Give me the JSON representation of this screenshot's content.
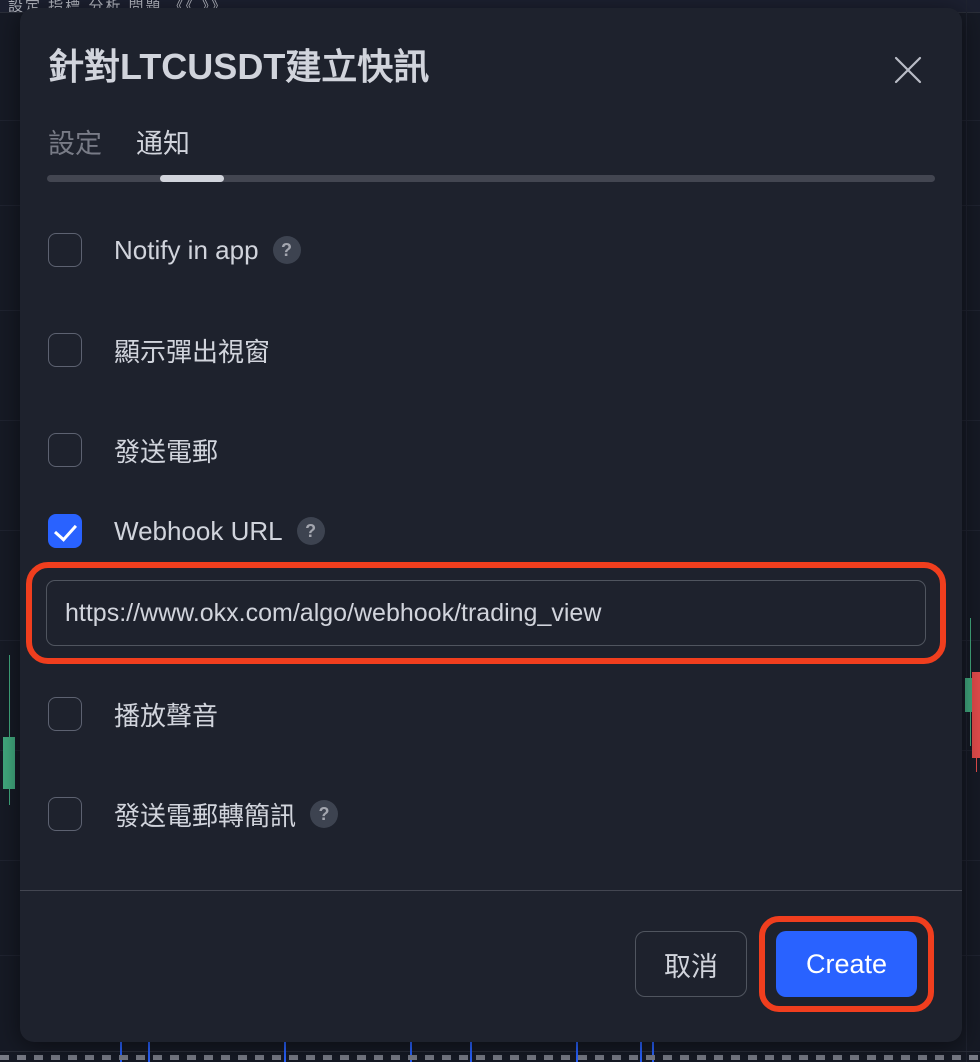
{
  "background": {
    "toolbar_text": "設定  指標  分析  問題   《《   》》"
  },
  "dialog": {
    "title": "針對LTCUSDT建立快訊",
    "close_icon": "close-icon",
    "tabs": [
      {
        "label": "設定",
        "active": false
      },
      {
        "label": "通知",
        "active": true
      }
    ],
    "options": [
      {
        "label": "Notify in app",
        "checked": false,
        "help": "?"
      },
      {
        "label": "顯示彈出視窗",
        "checked": false,
        "help": ""
      },
      {
        "label": "發送電郵",
        "checked": false,
        "help": ""
      },
      {
        "label": "Webhook URL",
        "checked": true,
        "help": "?"
      },
      {
        "label": "播放聲音",
        "checked": false,
        "help": ""
      },
      {
        "label": "發送電郵轉簡訊",
        "checked": false,
        "help": "?"
      }
    ],
    "webhook": {
      "value": "https://www.okx.com/algo/webhook/trading_view",
      "placeholder": "https://"
    },
    "footer": {
      "cancel_label": "取消",
      "create_label": "Create"
    }
  },
  "colors": {
    "accent_blue": "#2962ff",
    "annotation_red": "#f03e1e",
    "modal_bg": "#1e222d",
    "text_primary": "#d1d4dc",
    "text_muted": "#787b86",
    "candle_up": "#41a87e",
    "candle_down": "#e14b4b"
  }
}
